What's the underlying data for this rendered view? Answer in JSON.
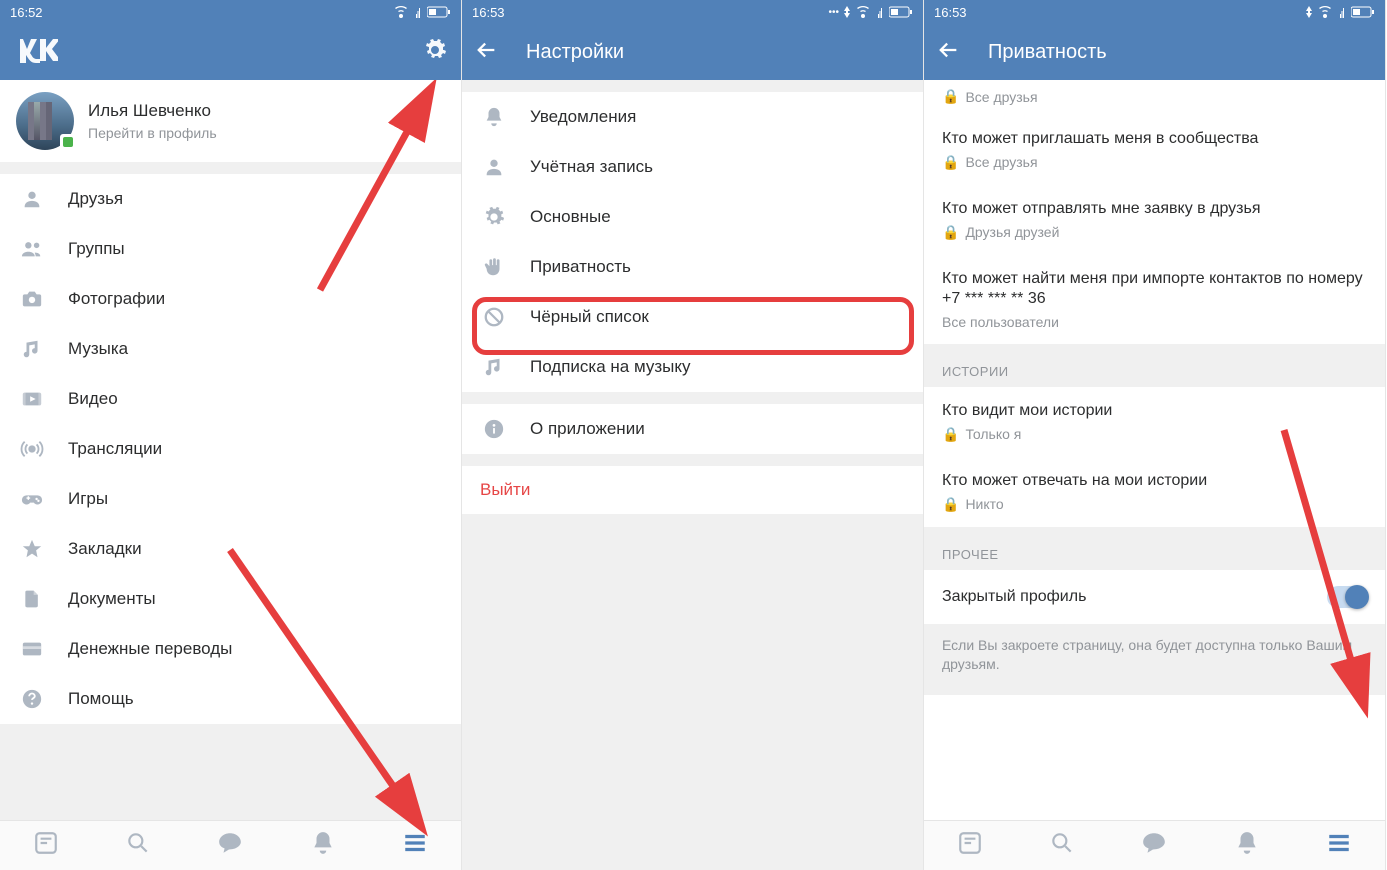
{
  "screen1": {
    "time": "16:52",
    "profile": {
      "name": "Илья Шевченко",
      "sub": "Перейти в профиль"
    },
    "menu": [
      {
        "label": "Друзья",
        "icon": "person"
      },
      {
        "label": "Группы",
        "icon": "people"
      },
      {
        "label": "Фотографии",
        "icon": "camera"
      },
      {
        "label": "Музыка",
        "icon": "music"
      },
      {
        "label": "Видео",
        "icon": "video"
      },
      {
        "label": "Трансляции",
        "icon": "live"
      },
      {
        "label": "Игры",
        "icon": "games"
      },
      {
        "label": "Закладки",
        "icon": "star"
      },
      {
        "label": "Документы",
        "icon": "doc"
      },
      {
        "label": "Денежные переводы",
        "icon": "card"
      },
      {
        "label": "Помощь",
        "icon": "help"
      }
    ]
  },
  "screen2": {
    "time": "16:53",
    "title": "Настройки",
    "items": [
      {
        "label": "Уведомления",
        "icon": "bell"
      },
      {
        "label": "Учётная запись",
        "icon": "account"
      },
      {
        "label": "Основные",
        "icon": "gear"
      },
      {
        "label": "Приватность",
        "icon": "hand"
      },
      {
        "label": "Чёрный список",
        "icon": "block"
      },
      {
        "label": "Подписка на музыку",
        "icon": "music"
      }
    ],
    "about": "О приложении",
    "logout": "Выйти"
  },
  "screen3": {
    "time": "16:53",
    "title": "Приватность",
    "top_item": {
      "sub": "Все друзья"
    },
    "items": [
      {
        "title": "Кто может приглашать меня в сообщества",
        "sub": "Все друзья",
        "lock": true
      },
      {
        "title": "Кто может отправлять мне заявку в друзья",
        "sub": "Друзья друзей",
        "lock": true
      },
      {
        "title": "Кто может найти меня при импорте контактов по номеру +7 *** *** ** 36",
        "sub": "Все пользователи",
        "lock": false
      }
    ],
    "section_stories": "ИСТОРИИ",
    "stories": [
      {
        "title": "Кто видит мои истории",
        "sub": "Только я",
        "lock": true
      },
      {
        "title": "Кто может отвечать на мои истории",
        "sub": "Никто",
        "lock": true
      }
    ],
    "section_other": "ПРОЧЕЕ",
    "toggle_label": "Закрытый профиль",
    "toggle_on": true,
    "desc": "Если Вы закроете страницу, она будет доступна только Вашим друзьям."
  }
}
